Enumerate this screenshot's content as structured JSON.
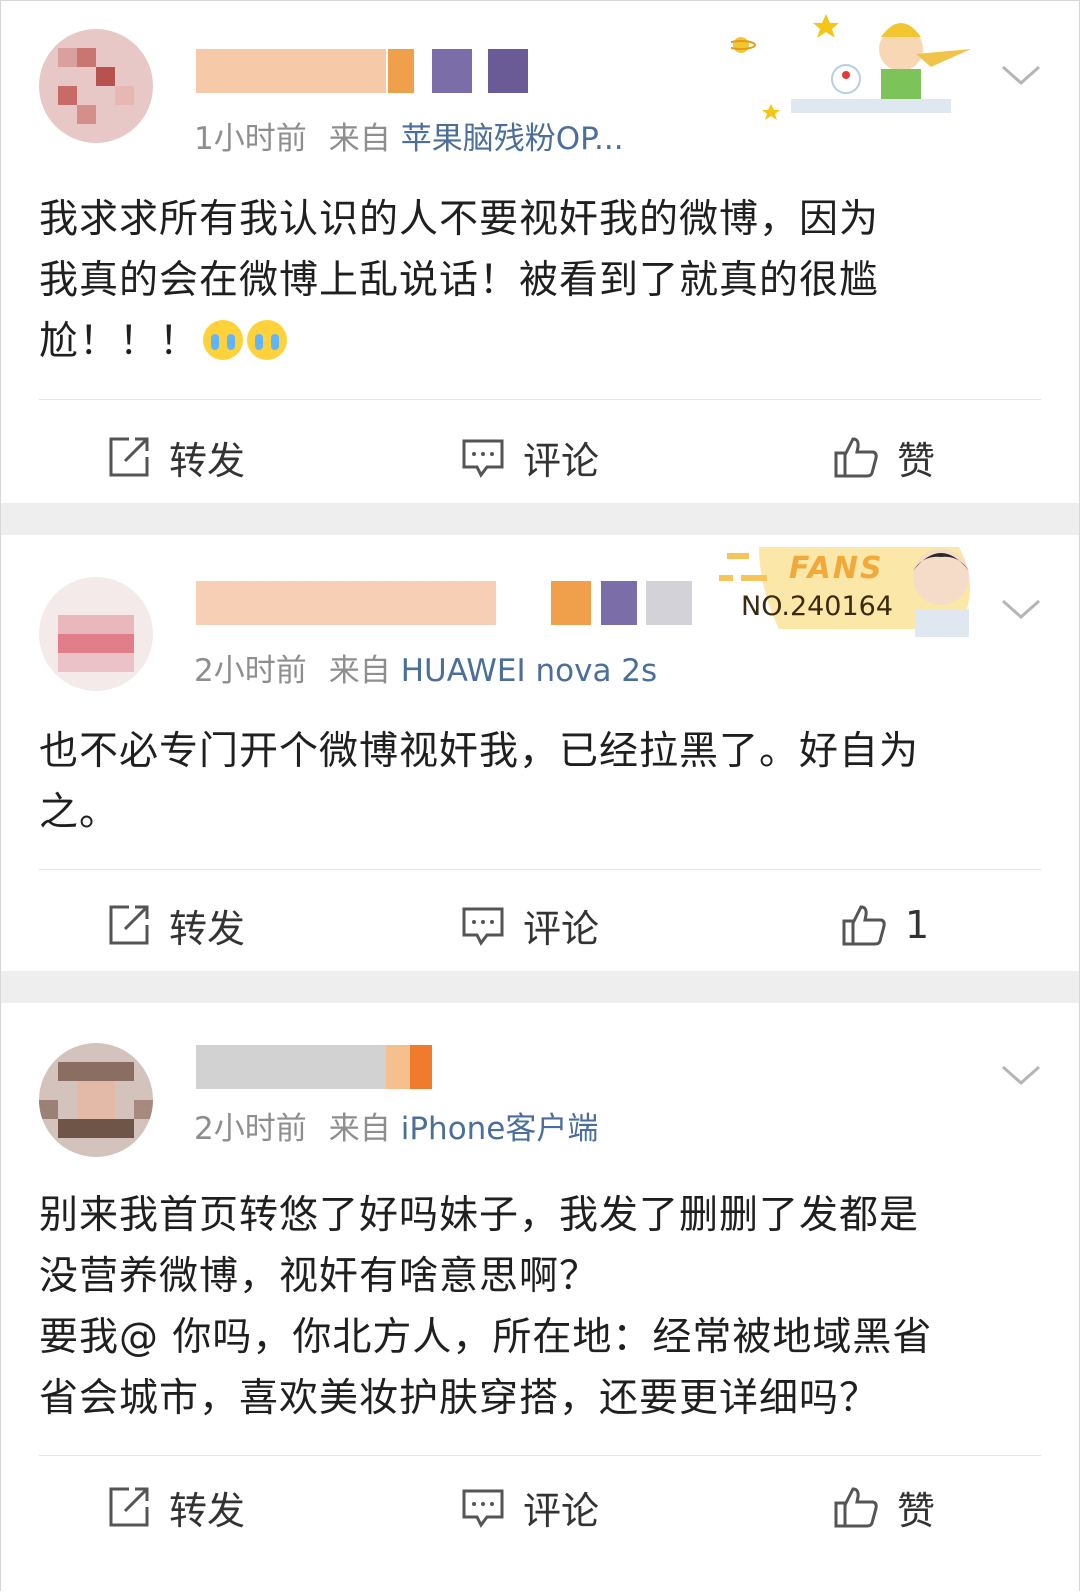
{
  "posts": [
    {
      "time": "1小时前",
      "from_label": "来自",
      "source": "苹果脑残粉OP...",
      "content": [
        "我求求所有我认识的人不要视奸我的微博，因为",
        "我真的会在微博上乱说话！被看到了就真的很尴",
        "尬！！！"
      ],
      "emoji": [
        "crying-face",
        "crying-face"
      ],
      "actions": {
        "repost": "转发",
        "comment": "评论",
        "like": "赞"
      }
    },
    {
      "time": "2小时前",
      "from_label": "来自",
      "source": "HUAWEI nova 2s",
      "badge": {
        "title": "FANS",
        "number": "NO.240164"
      },
      "content": [
        "也不必专门开个微博视奸我，已经拉黑了。好自为",
        "之。"
      ],
      "actions": {
        "repost": "转发",
        "comment": "评论",
        "like": "1"
      }
    },
    {
      "time": "2小时前",
      "from_label": "来自",
      "source": "iPhone客户端",
      "content": [
        "别来我首页转悠了好吗妹子，我发了删删了发都是",
        "没营养微博，视奸有啥意思啊？",
        "要我@ 你吗，你北方人，所在地：经常被地域黑省",
        "省会城市，喜欢美妆护肤穿搭，还要更详细吗？"
      ],
      "actions": {
        "repost": "转发",
        "comment": "评论",
        "like": "赞"
      }
    }
  ],
  "colors": {
    "source_link": "#4b6f9a",
    "meta_gray": "#8e8e8e",
    "separator": "#eeeeee"
  }
}
